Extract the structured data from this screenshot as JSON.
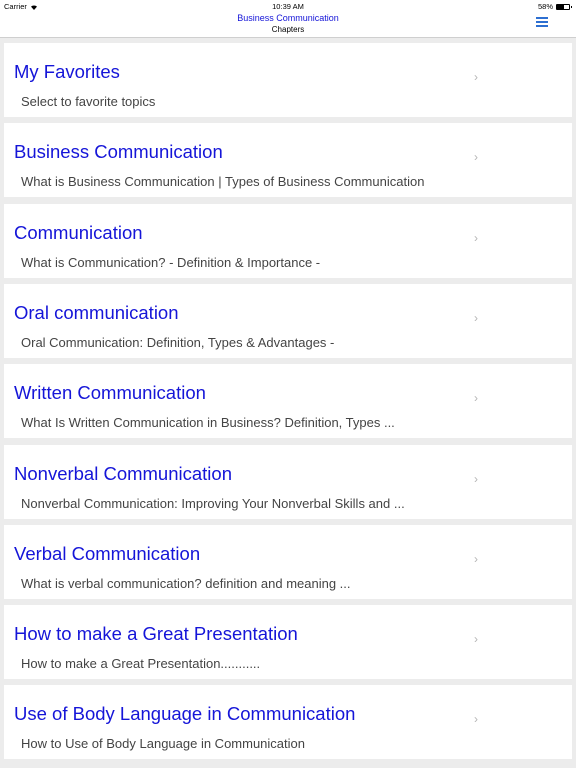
{
  "status_bar": {
    "carrier": "Carrier",
    "time": "10:39 AM",
    "battery_label": "58%",
    "battery_level": 0.58
  },
  "nav": {
    "title": "Business Communication",
    "subtitle": "Chapters",
    "menu_icon": "hamburger-menu-icon",
    "accent_color": "#1515d8"
  },
  "items": [
    {
      "title": "My Favorites",
      "subtitle": "Select to favorite topics"
    },
    {
      "title": "Business Communication",
      "subtitle": "What is Business Communication | Types of Business Communication"
    },
    {
      "title": "Communication",
      "subtitle": "What is Communication? - Definition & Importance -"
    },
    {
      "title": "Oral communication",
      "subtitle": "Oral Communication: Definition, Types & Advantages -"
    },
    {
      "title": "Written Communication",
      "subtitle": "What Is Written Communication in Business? Definition, Types ..."
    },
    {
      "title": "Nonverbal Communication",
      "subtitle": "Nonverbal Communication: Improving Your Nonverbal Skills and ..."
    },
    {
      "title": "Verbal Communication",
      "subtitle": "What is verbal communication? definition and meaning ..."
    },
    {
      "title": "How to make a Great Presentation",
      "subtitle": "How to make a Great Presentation..........."
    },
    {
      "title": "Use of Body Language in Communication",
      "subtitle": "How to Use of Body Language in Communication"
    }
  ],
  "chevron": "›"
}
